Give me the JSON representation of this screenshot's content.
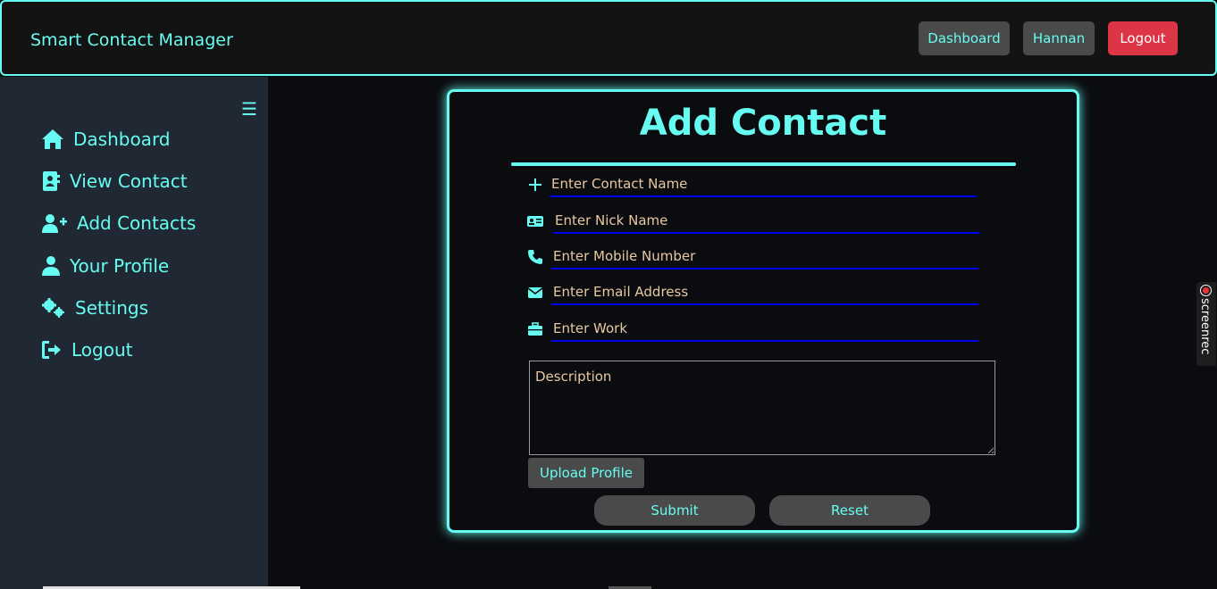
{
  "navbar": {
    "brand": "Smart Contact Manager",
    "dashboard_label": "Dashboard",
    "user_label": "Hannan",
    "logout_label": "Logout"
  },
  "sidebar": {
    "items": [
      {
        "label": "Dashboard",
        "icon": "home-icon"
      },
      {
        "label": "View Contact",
        "icon": "address-book-icon"
      },
      {
        "label": "Add Contacts",
        "icon": "user-plus-icon"
      },
      {
        "label": "Your Profile",
        "icon": "user-icon"
      },
      {
        "label": "Settings",
        "icon": "cogs-icon"
      },
      {
        "label": "Logout",
        "icon": "sign-out-icon"
      }
    ]
  },
  "form": {
    "title": "Add Contact",
    "name_placeholder": "Enter Contact Name",
    "nick_placeholder": "Enter Nick Name",
    "mobile_placeholder": "Enter Mobile Number",
    "email_placeholder": "Enter Email Address",
    "work_placeholder": "Enter Work",
    "description_placeholder": "Description",
    "upload_label": "Upload Profile",
    "submit_label": "Submit",
    "reset_label": "Reset"
  },
  "overlay": {
    "screenrec_label": "screenrec"
  },
  "colors": {
    "accent": "#66fcf1",
    "background": "#0b0c10",
    "sidebar": "#1f2833",
    "danger": "#dc3545",
    "input_underline": "#0000ee",
    "placeholder_text": "#e8c8a0"
  }
}
